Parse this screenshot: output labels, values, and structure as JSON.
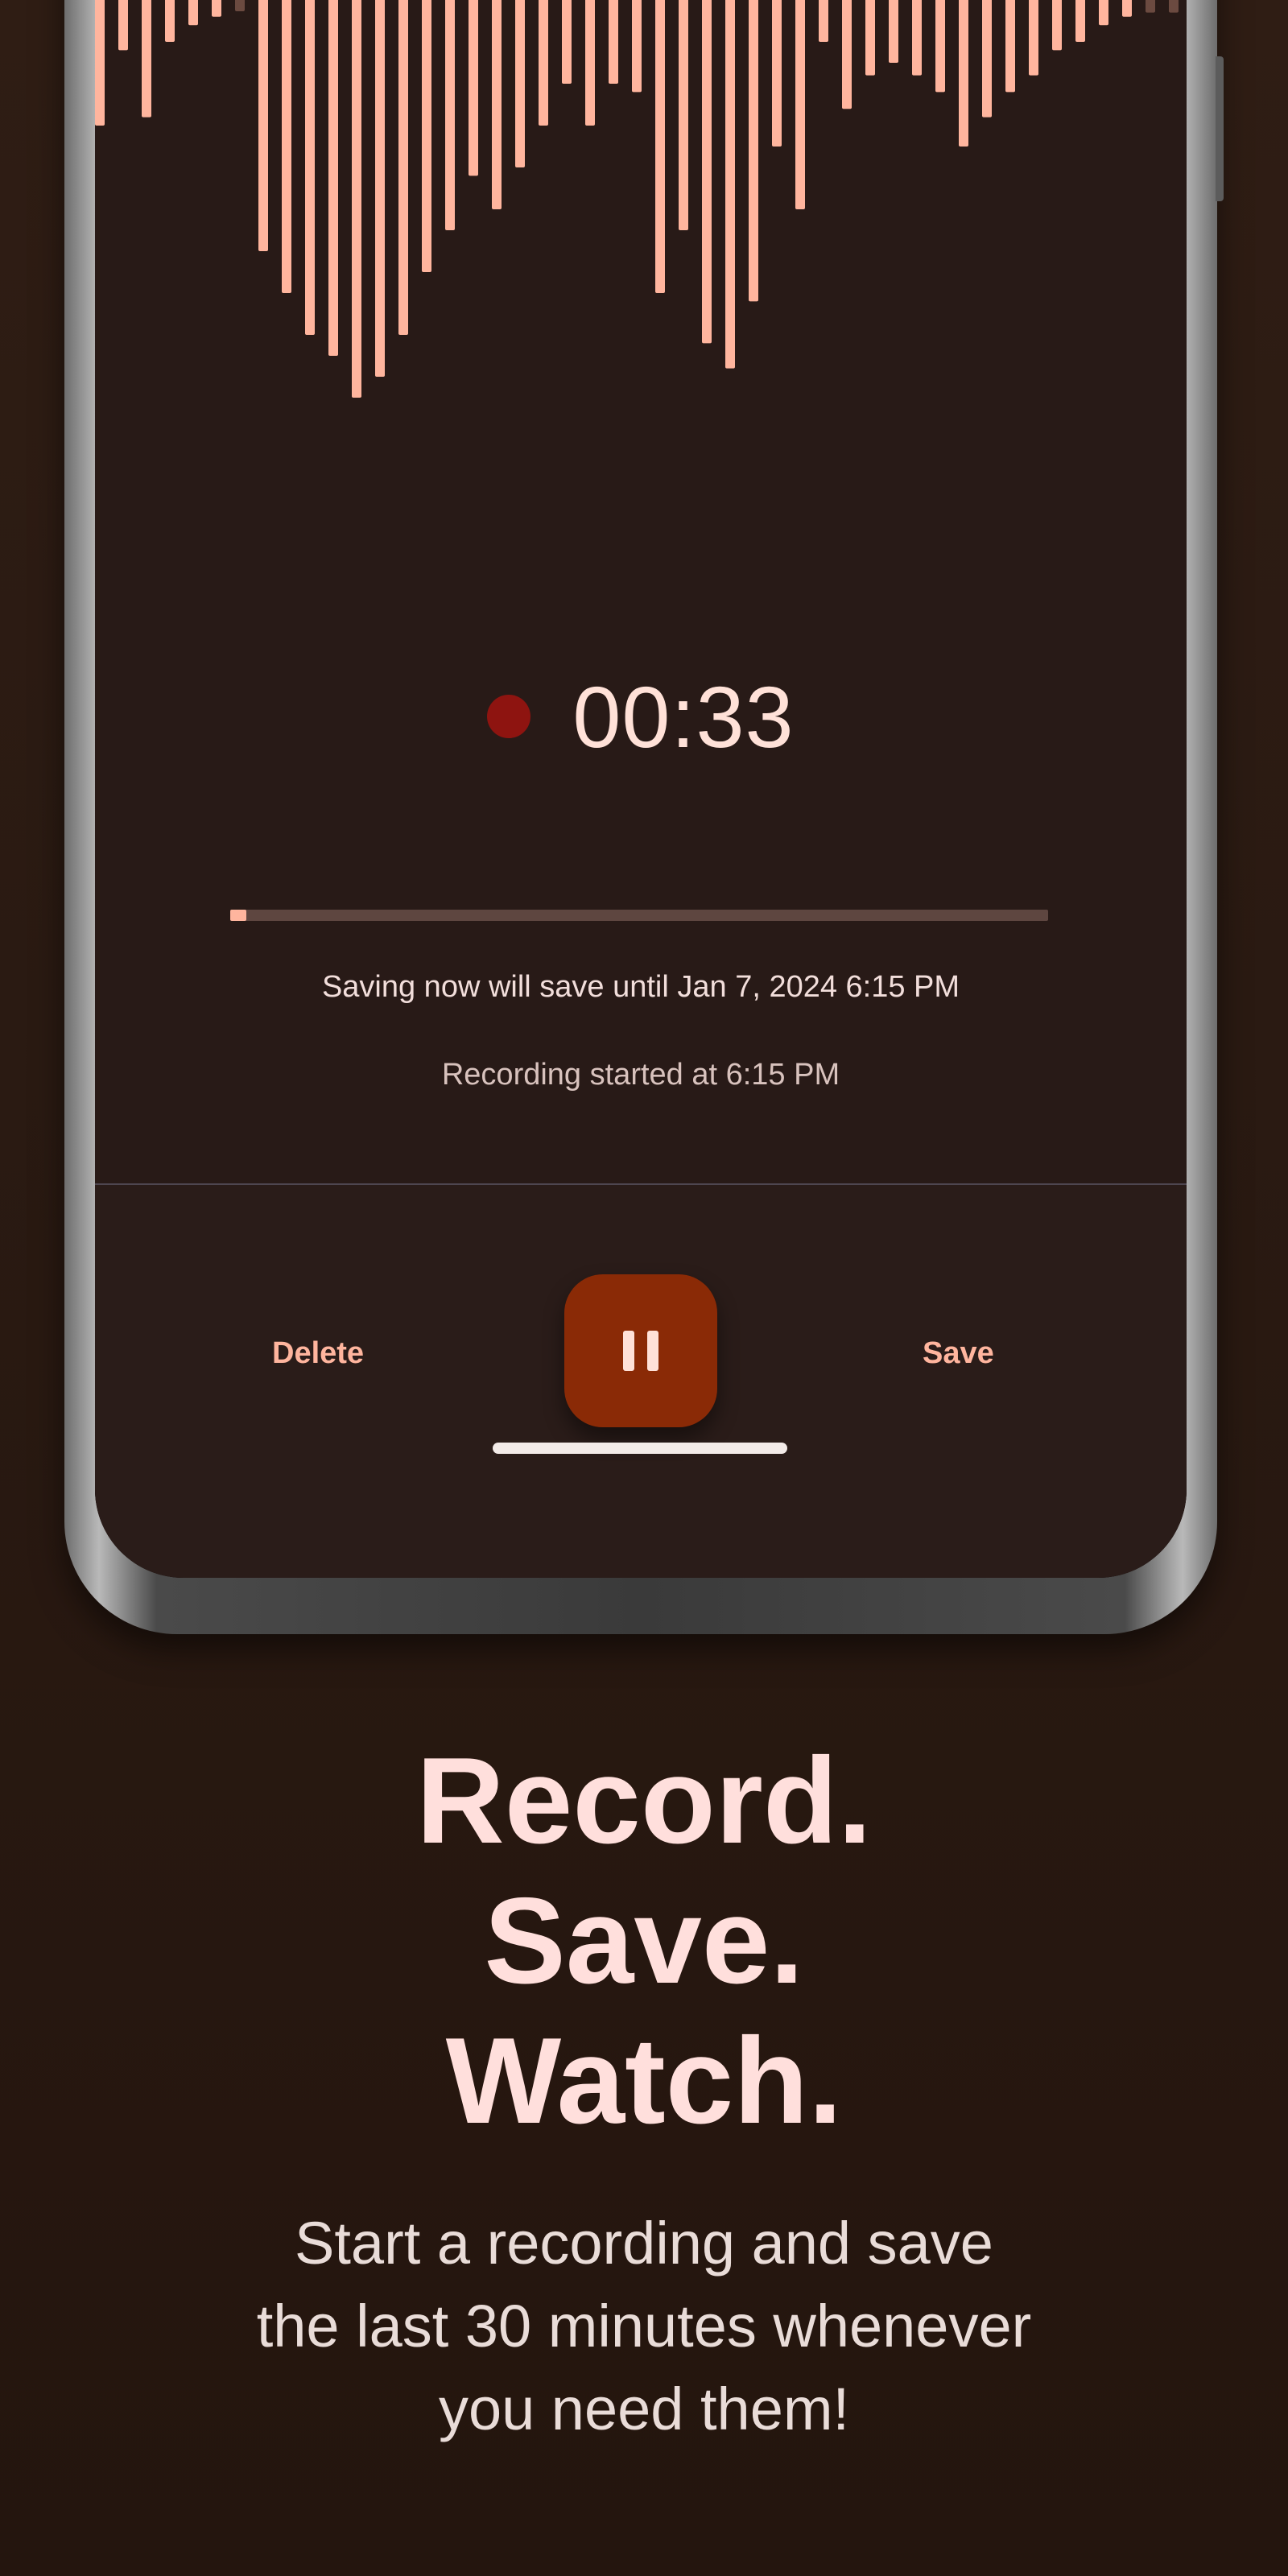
{
  "recorder": {
    "elapsed": "00:33",
    "progress_fraction": 0.02,
    "save_note": "Saving now will save until Jan 7, 2024 6:15 PM",
    "started_note": "Recording started at 6:15 PM",
    "delete_label": "Delete",
    "save_label": "Save",
    "pause_icon": "pause-icon"
  },
  "promo": {
    "headline": [
      "Record.",
      "Save.",
      "Watch."
    ],
    "subtitle": [
      "Start a recording and save",
      "the last 30 minutes whenever",
      "you need them!"
    ]
  },
  "colors": {
    "accent": "#ffb59e",
    "pause_button": "#8a2a06",
    "record_dot": "#8e1410",
    "screen_bg": "#281a17",
    "page_bg": "#2a1a12",
    "headline": "#ffdfdc"
  },
  "waveform": {
    "amplitudes": [
      0.3,
      0.12,
      0.28,
      0.1,
      0.06,
      0.04,
      0.0,
      0.6,
      0.7,
      0.8,
      0.85,
      0.95,
      0.9,
      0.8,
      0.65,
      0.55,
      0.42,
      0.5,
      0.4,
      0.3,
      0.2,
      0.3,
      0.2,
      0.22,
      0.7,
      0.55,
      0.82,
      0.88,
      0.72,
      0.35,
      0.5,
      0.1,
      0.26,
      0.18,
      0.15,
      0.18,
      0.22,
      0.35,
      0.28,
      0.22,
      0.18,
      0.12,
      0.1,
      0.06,
      0.04,
      0.03,
      0.03,
      0.02,
      0.02,
      0.02,
      0.02,
      0.01
    ]
  }
}
